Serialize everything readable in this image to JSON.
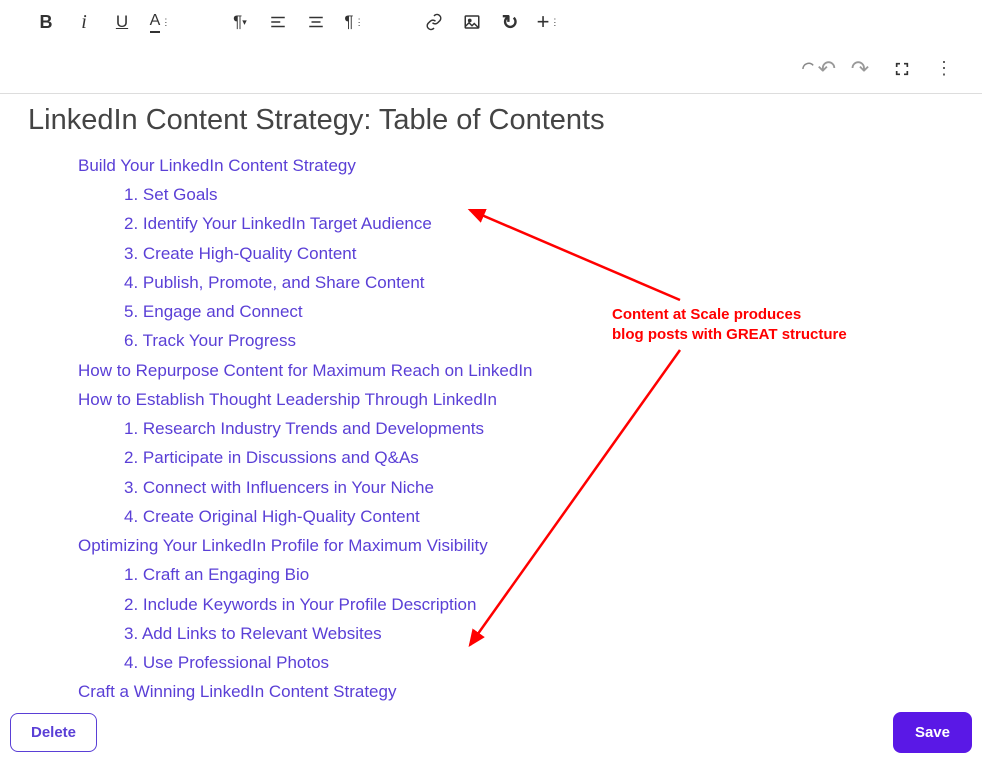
{
  "toolbar": {
    "bold": "B",
    "italic": "i",
    "underline": "U",
    "textcolor": "A"
  },
  "title": "LinkedIn Content Strategy: Table of Contents",
  "toc": [
    {
      "label": "Build Your LinkedIn Content Strategy",
      "sub": [
        "1. Set Goals",
        "2. Identify Your LinkedIn Target Audience",
        "3. Create High-Quality Content",
        "4. Publish, Promote, and Share Content",
        "5. Engage and Connect",
        "6. Track Your Progress"
      ]
    },
    {
      "label": "How to Repurpose Content for Maximum Reach on LinkedIn",
      "sub": []
    },
    {
      "label": "How to Establish Thought Leadership Through LinkedIn",
      "sub": [
        "1. Research Industry Trends and Developments",
        "2. Participate in Discussions and Q&As",
        "3. Connect with Influencers in Your Niche",
        "4. Create Original High-Quality Content"
      ]
    },
    {
      "label": "Optimizing Your LinkedIn Profile for Maximum Visibility",
      "sub": [
        "1. Craft an Engaging Bio",
        "2. Include Keywords in Your Profile Description",
        "3. Add Links to Relevant Websites",
        "4. Use Professional Photos"
      ]
    },
    {
      "label": "Craft a Winning LinkedIn Content Strategy",
      "sub": []
    }
  ],
  "annotation": {
    "line1": "Content at Scale produces",
    "line2": "blog posts with GREAT structure"
  },
  "buttons": {
    "delete": "Delete",
    "save": "Save"
  }
}
